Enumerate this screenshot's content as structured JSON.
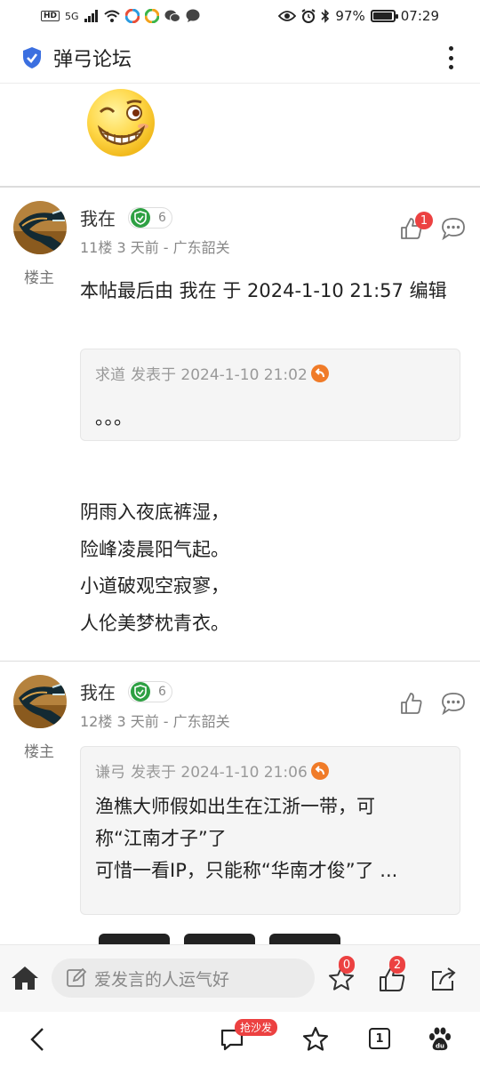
{
  "status_bar": {
    "hd": "HD",
    "network": "5G",
    "battery": "97%",
    "battery_level": 0.97,
    "time": "07:29"
  },
  "header": {
    "title": "弹弓论坛"
  },
  "posts": [
    {
      "author": "我在",
      "level": "6",
      "floor_meta": "11楼   3 天前 - 广东韶关",
      "op_label": "楼主",
      "like_count": "1",
      "edit_note": "本帖最后由 我在 于 2024-1-10 21:57 编辑",
      "quote_meta_user": "求道",
      "quote_meta_date": "发表于 2024-1-10 21:02",
      "quote_text": "。。。",
      "poem": [
        "阴雨入夜底裤湿，",
        "险峰凌晨阳气起。",
        "小道破观空寂寥，",
        "人伦美梦枕青衣。"
      ]
    },
    {
      "author": "我在",
      "level": "6",
      "floor_meta": "12楼   3 天前 - 广东韶关",
      "op_label": "楼主",
      "quote_meta_user": "谦弓",
      "quote_meta_date": "发表于 2024-1-10 21:06",
      "quote_lines": [
        "渔樵大师假如出生在江浙一带，可",
        "称“江南才子”了",
        "可惜一看IP，只能称“华南才俊”了 ..."
      ]
    }
  ],
  "action_bar": {
    "input_placeholder": "爱发言的人运气好",
    "favorite_count": "0",
    "like_count": "2"
  },
  "nav_bar": {
    "promo_label": "抢沙发",
    "tab_count": "1"
  },
  "colors": {
    "accent_red": "#ec4141",
    "badge_green": "#2ea043",
    "shield_blue": "#3b6fe0"
  }
}
